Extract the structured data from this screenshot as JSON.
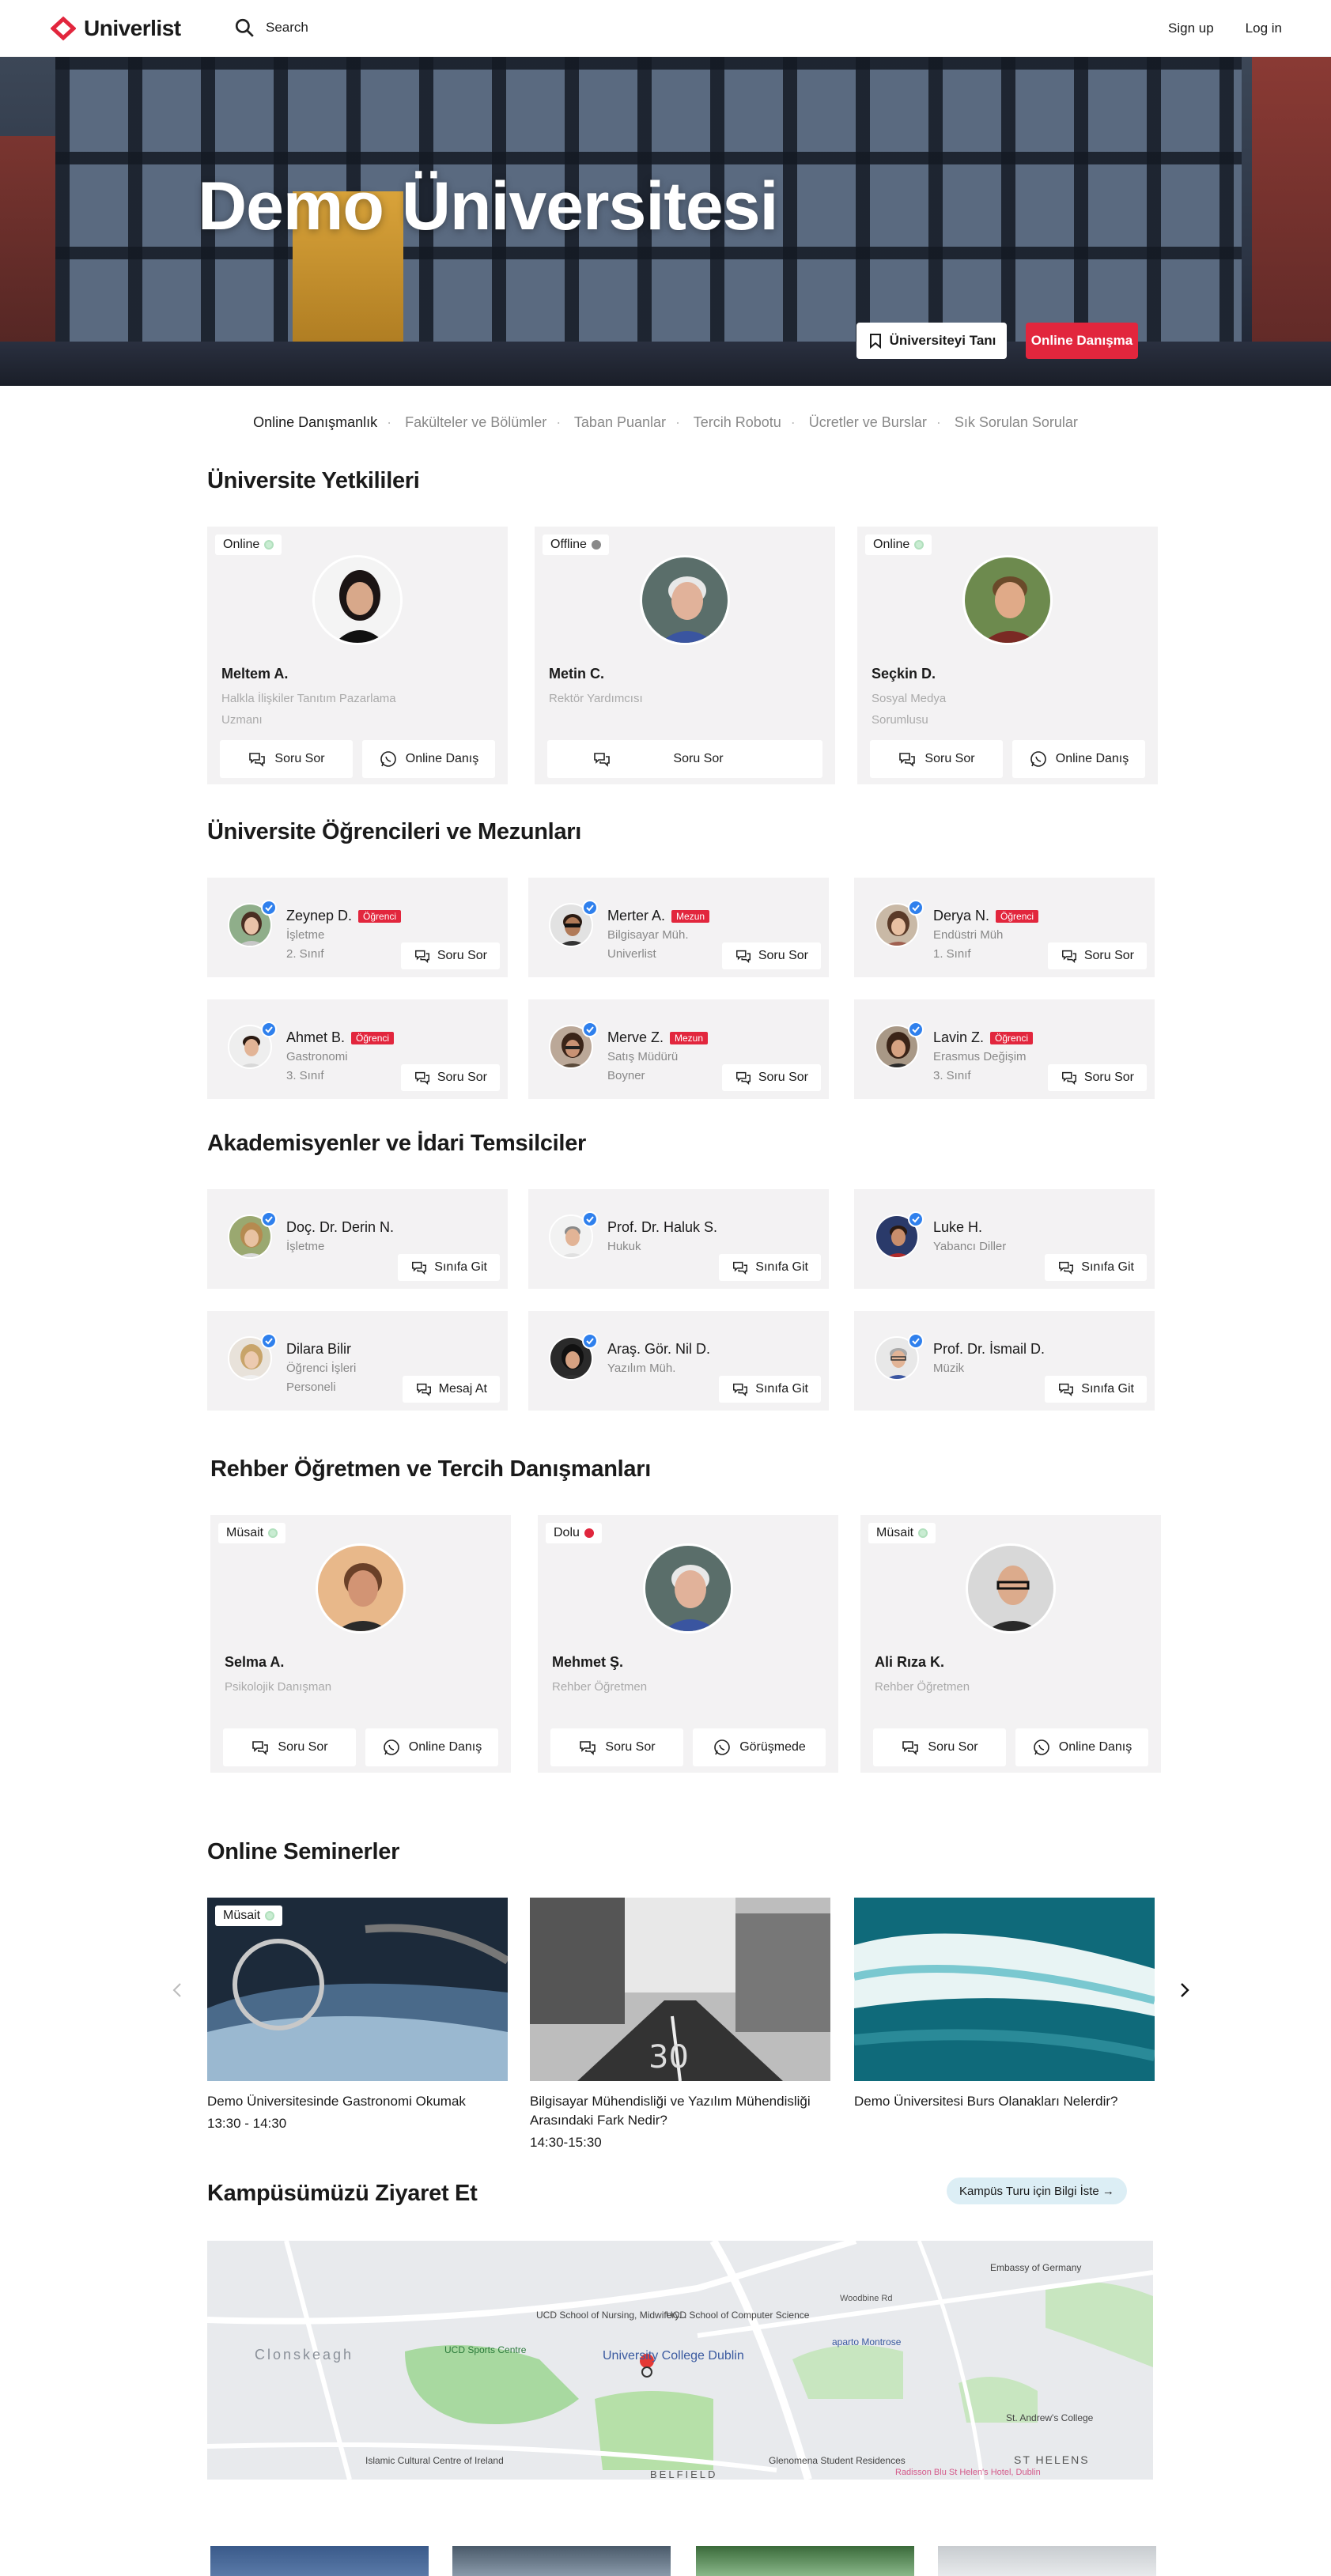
{
  "header": {
    "brand": "Univerlist",
    "search_label": "Search",
    "signup": "Sign up",
    "login": "Log in"
  },
  "hero": {
    "title": "Demo Üniversitesi",
    "btn_know": "Üniversiteyi Tanı",
    "btn_consult": "Online Danışma"
  },
  "subnav": [
    "Online Danışmanlık",
    "Fakülteler ve Bölümler",
    "Taban Puanlar",
    "Tercih Robotu",
    "Ücretler ve Burslar",
    "Sık Sorulan Sorular"
  ],
  "officials": {
    "title": "Üniversite Yetkilileri",
    "cards": [
      {
        "status": "Online",
        "name": "Meltem A.",
        "role": "Halkla İlişkiler Tanıtım Pazarlama Uzmanı",
        "btn1": "Soru Sor",
        "btn2": "Online Danış"
      },
      {
        "status": "Offline",
        "name": "Metin C.",
        "role": "Rektör Yardımcısı",
        "btn1": "Soru Sor"
      },
      {
        "status": "Online",
        "name": "Seçkin D.",
        "role": "Sosyal Medya Sorumlusu",
        "btn1": "Soru Sor",
        "btn2": "Online Danış"
      }
    ]
  },
  "students": {
    "title": "Üniversite Öğrencileri ve Mezunları",
    "cards": [
      {
        "name": "Zeynep D.",
        "tag": "Öğrenci",
        "line1": "İşletme",
        "line2": "2. Sınıf",
        "btn": "Soru Sor"
      },
      {
        "name": "Merter A.",
        "tag": "Mezun",
        "line1": "Bilgisayar Müh.",
        "line2": "Univerlist",
        "btn": "Soru Sor"
      },
      {
        "name": "Derya N.",
        "tag": "Öğrenci",
        "line1": "Endüstri Müh",
        "line2": "1. Sınıf",
        "btn": "Soru Sor"
      },
      {
        "name": "Ahmet B.",
        "tag": "Öğrenci",
        "line1": "Gastronomi",
        "line2": "3. Sınıf",
        "btn": "Soru Sor"
      },
      {
        "name": "Merve Z.",
        "tag": "Mezun",
        "line1": "Satış Müdürü",
        "line2": "Boyner",
        "btn": "Soru Sor"
      },
      {
        "name": "Lavin Z.",
        "tag": "Öğrenci",
        "line1": "Erasmus Değişim",
        "line2": "3. Sınıf",
        "btn": "Soru Sor"
      }
    ]
  },
  "academics": {
    "title": "Akademisyenler ve İdari Temsilciler",
    "cards": [
      {
        "name": "Doç. Dr. Derin N.",
        "line1": "İşletme",
        "line2": "",
        "btn": "Sınıfa Git"
      },
      {
        "name": "Prof. Dr. Haluk S.",
        "line1": "Hukuk",
        "line2": "",
        "btn": "Sınıfa Git"
      },
      {
        "name": "Luke H.",
        "line1": "Yabancı Diller",
        "line2": "",
        "btn": "Sınıfa Git"
      },
      {
        "name": "Dilara Bilir",
        "line1": "Öğrenci İşleri",
        "line2": "Personeli",
        "btn": "Mesaj At"
      },
      {
        "name": "Araş. Gör. Nil D.",
        "line1": "Yazılım Müh.",
        "line2": "",
        "btn": "Sınıfa Git"
      },
      {
        "name": "Prof. Dr. İsmail D.",
        "line1": "Müzik",
        "line2": "",
        "btn": "Sınıfa Git"
      }
    ]
  },
  "counselors": {
    "title": "Rehber Öğretmen ve Tercih Danışmanları",
    "cards": [
      {
        "status": "Müsait",
        "name": "Selma A.",
        "role": "Psikolojik Danışman",
        "btn1": "Soru Sor",
        "btn2": "Online Danış"
      },
      {
        "status": "Dolu",
        "name": "Mehmet Ş.",
        "role": "Rehber Öğretmen",
        "btn1": "Soru Sor",
        "btn2": "Görüşmede"
      },
      {
        "status": "Müsait",
        "name": "Ali Rıza K.",
        "role": "Rehber Öğretmen",
        "btn1": "Soru Sor",
        "btn2": "Online Danış"
      }
    ]
  },
  "seminars": {
    "title": "Online Seminerler",
    "badge": "Müsait",
    "items": [
      {
        "title": "Demo Üniversitesinde Gastronomi Okumak",
        "time": "13:30 - 14:30"
      },
      {
        "title": "Bilgisayar Mühendisliği ve Yazılım Mühendisliği Arasındaki Fark Nedir?",
        "time": "14:30-15:30"
      },
      {
        "title": "Demo Üniversitesi Burs Olanakları Nelerdir?",
        "time": ""
      }
    ]
  },
  "campus": {
    "title": "Kampüsümüzü Ziyaret Et",
    "button": "Kampüs Turu için Bilgi İste →",
    "map_labels": {
      "ucd_school_nursing": "UCD School of Nursing, Midwifery...",
      "ucd_school_cs": "UCD School of Computer Science",
      "embassy": "Embassy of Germany",
      "sports": "UCD Sports Centre",
      "university": "University College Dublin",
      "aparto": "aparto Montrose",
      "clonskeagh": "Clonskeagh",
      "st_andrews": "St. Andrew's College",
      "islamic": "Islamic Cultural Centre of Ireland",
      "glenomena": "Glenomena Student Residences",
      "st_helens": "ST HELENS",
      "belfield": "BELFIELD",
      "woodbine": "Woodbine Rd",
      "helens_hotel": "Radisson Blu St Helen's Hotel, Dublin"
    }
  },
  "colors": {
    "brand_red": "#e2263d",
    "online_green": "#c9ecd2",
    "verified_blue": "#2f80ed"
  }
}
